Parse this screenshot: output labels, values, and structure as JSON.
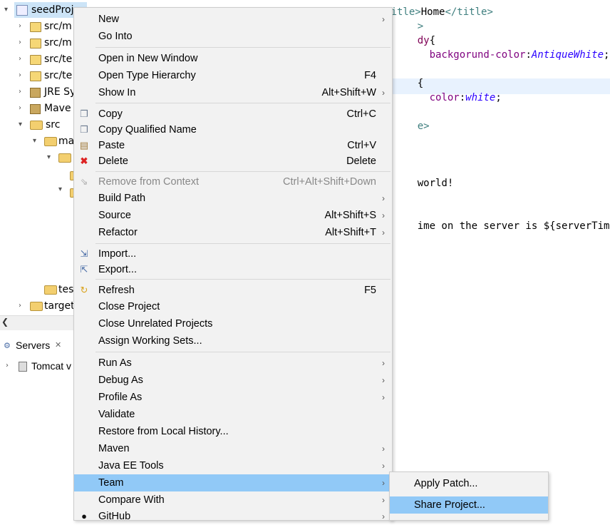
{
  "explorer": {
    "rows": [
      {
        "label": "seedProj"
      },
      {
        "label": "src/m"
      },
      {
        "label": "src/m"
      },
      {
        "label": "src/te"
      },
      {
        "label": "src/te"
      },
      {
        "label": "JRE Sy"
      },
      {
        "label": "Mave"
      },
      {
        "label": "src"
      },
      {
        "label": "ma"
      },
      {
        "label": "tes"
      },
      {
        "label": "target"
      }
    ]
  },
  "servers": {
    "tab_label": "Servers",
    "tab_close": "✕",
    "tomcat_label": "Tomcat v"
  },
  "editor": {
    "lines": [
      {
        "parts": [
          {
            "t": "<title>",
            "c": "tag"
          },
          {
            "t": "Home",
            "c": ""
          },
          {
            "t": "</title>",
            "c": "tag"
          }
        ]
      },
      {
        "parts": [
          {
            "t": ">",
            "c": "tag"
          }
        ]
      },
      {
        "parts": [
          {
            "t": "dy",
            "c": "kw"
          },
          {
            "t": "{",
            "c": ""
          }
        ]
      },
      {
        "parts": [
          {
            "t": "  backgorund-color",
            "c": "prop"
          },
          {
            "t": ":",
            "c": ""
          },
          {
            "t": "AntiqueWhite",
            "c": "val"
          },
          {
            "t": ";",
            "c": ""
          }
        ]
      },
      {
        "parts": [
          {
            "t": "{",
            "c": ""
          }
        ]
      },
      {
        "parts": [
          {
            "t": "  color",
            "c": "prop"
          },
          {
            "t": ":",
            "c": ""
          },
          {
            "t": "white",
            "c": "val"
          },
          {
            "t": ";",
            "c": ""
          }
        ]
      },
      {
        "parts": [
          {
            "t": "e>",
            "c": "tag"
          }
        ]
      },
      {
        "parts": [
          {
            "t": "world!",
            "c": ""
          }
        ]
      },
      {
        "parts": [
          {
            "t": "ime on the server is ${serverTime}",
            "c": ""
          }
        ]
      }
    ]
  },
  "menu": {
    "items": [
      {
        "label": "New",
        "accel": "",
        "submenu": true
      },
      {
        "label": "Go Into",
        "accel": "",
        "submenu": false
      },
      {
        "label": "Open in New Window",
        "accel": "",
        "submenu": false
      },
      {
        "label": "Open Type Hierarchy",
        "accel": "F4",
        "submenu": false
      },
      {
        "label": "Show In",
        "accel": "Alt+Shift+W",
        "submenu": true
      },
      {
        "label": "Copy",
        "accel": "Ctrl+C",
        "submenu": false
      },
      {
        "label": "Copy Qualified Name",
        "accel": "",
        "submenu": false
      },
      {
        "label": "Paste",
        "accel": "Ctrl+V",
        "submenu": false
      },
      {
        "label": "Delete",
        "accel": "Delete",
        "submenu": false
      },
      {
        "label": "Remove from Context",
        "accel": "Ctrl+Alt+Shift+Down",
        "submenu": false
      },
      {
        "label": "Build Path",
        "accel": "",
        "submenu": true
      },
      {
        "label": "Source",
        "accel": "Alt+Shift+S",
        "submenu": true
      },
      {
        "label": "Refactor",
        "accel": "Alt+Shift+T",
        "submenu": true
      },
      {
        "label": "Import...",
        "accel": "",
        "submenu": false
      },
      {
        "label": "Export...",
        "accel": "",
        "submenu": false
      },
      {
        "label": "Refresh",
        "accel": "F5",
        "submenu": false
      },
      {
        "label": "Close Project",
        "accel": "",
        "submenu": false
      },
      {
        "label": "Close Unrelated Projects",
        "accel": "",
        "submenu": false
      },
      {
        "label": "Assign Working Sets...",
        "accel": "",
        "submenu": false
      },
      {
        "label": "Run As",
        "accel": "",
        "submenu": true
      },
      {
        "label": "Debug As",
        "accel": "",
        "submenu": true
      },
      {
        "label": "Profile As",
        "accel": "",
        "submenu": true
      },
      {
        "label": "Validate",
        "accel": "",
        "submenu": false
      },
      {
        "label": "Restore from Local History...",
        "accel": "",
        "submenu": false
      },
      {
        "label": "Maven",
        "accel": "",
        "submenu": true
      },
      {
        "label": "Java EE Tools",
        "accel": "",
        "submenu": true
      },
      {
        "label": "Team",
        "accel": "",
        "submenu": true
      },
      {
        "label": "Compare With",
        "accel": "",
        "submenu": true
      },
      {
        "label": "GitHub",
        "accel": "",
        "submenu": true
      }
    ]
  },
  "team_submenu": {
    "items": [
      {
        "label": "Apply Patch..."
      },
      {
        "label": "Share Project..."
      }
    ]
  },
  "icons": {
    "submenu_arrow": "›",
    "expanded": "⌄",
    "collapsed": "›"
  }
}
